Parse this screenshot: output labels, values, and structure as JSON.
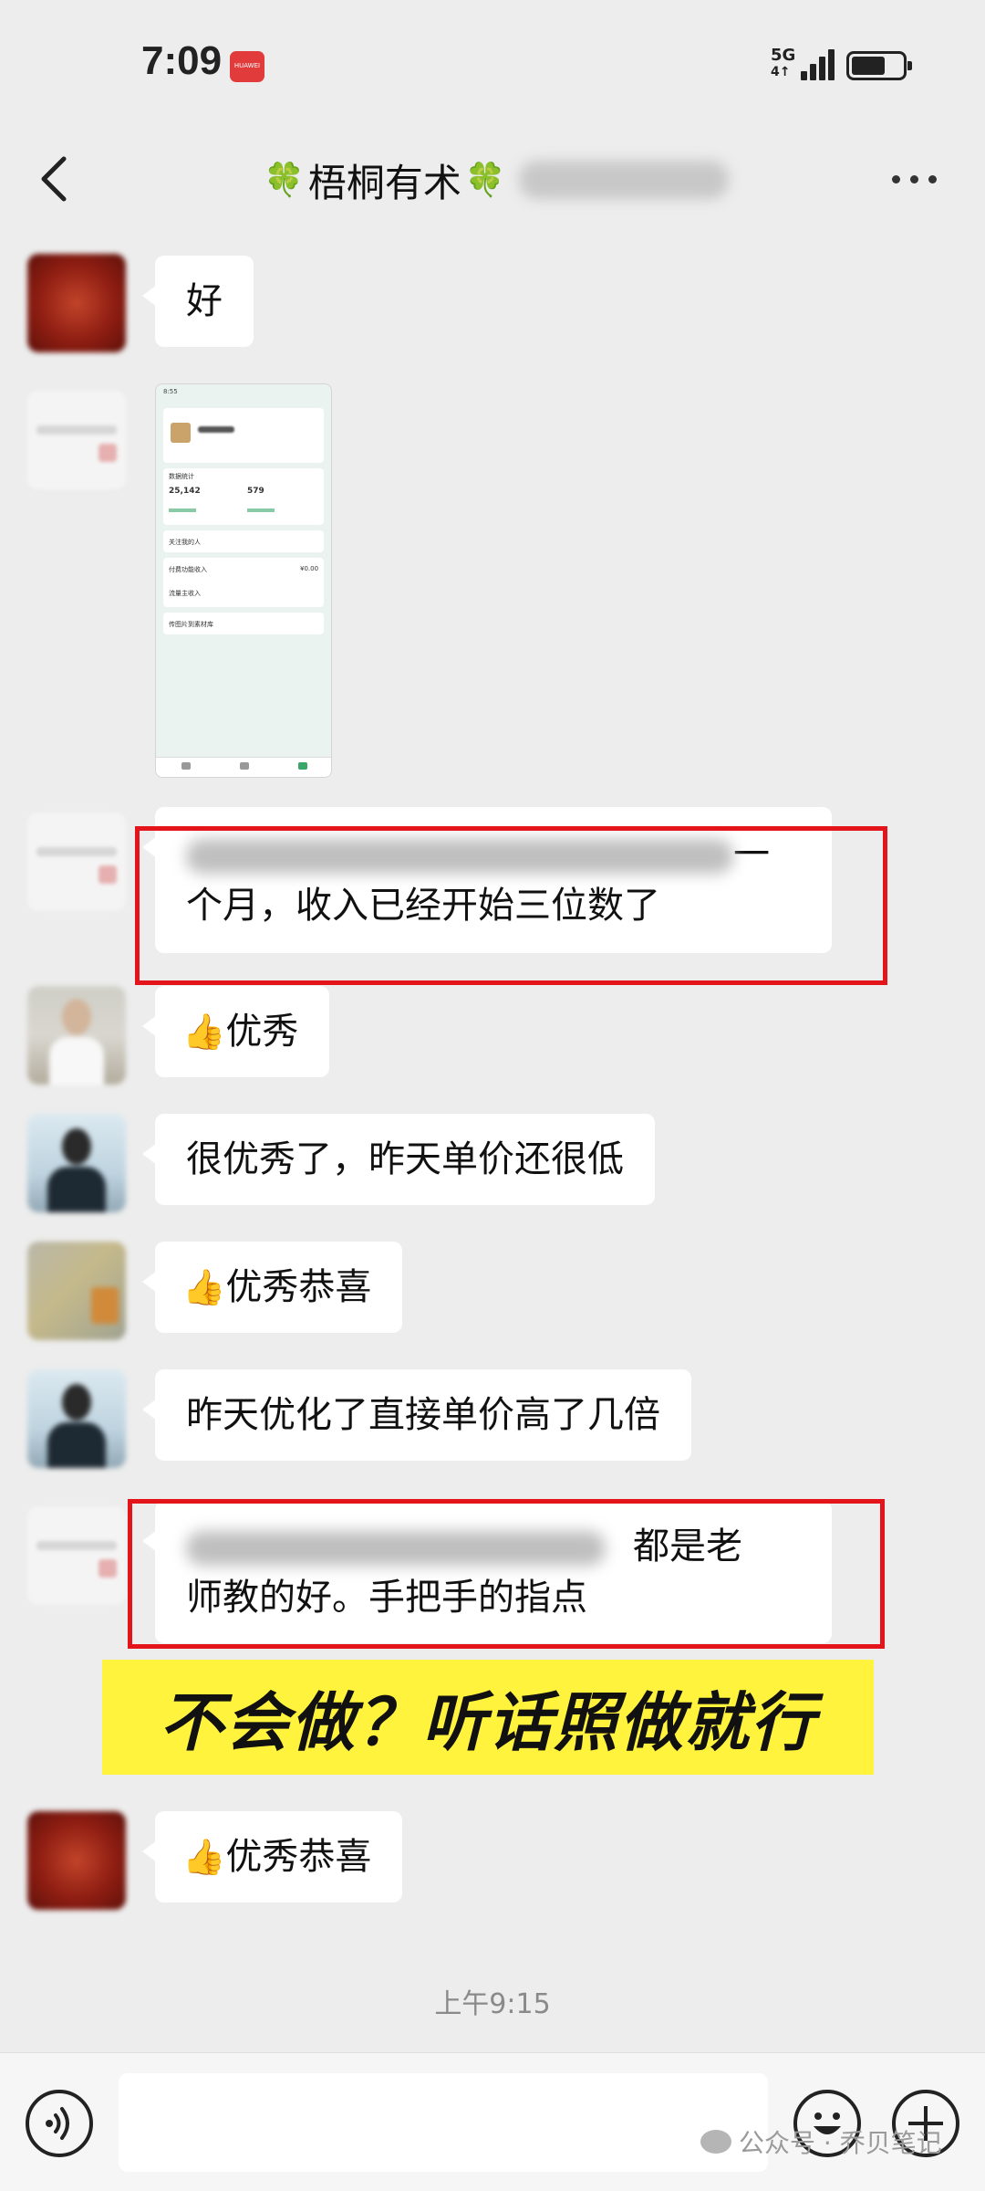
{
  "status_bar": {
    "time": "7:09",
    "notif_label": "HUAWEI",
    "network": "5G",
    "network_sub": "4↑"
  },
  "header": {
    "title": "梧桐有术",
    "clover_glyph": "🍀"
  },
  "messages": {
    "m1": "好",
    "m3_line2": "个月，收入已经开始三位数了",
    "m3_line1_tail": "一",
    "m4": "优秀",
    "m5": "很优秀了，昨天单价还很低",
    "m6": "优秀恭喜",
    "m7": "昨天优化了直接单价高了几倍",
    "m8_line1_tail": "都是老",
    "m8_line2": "师教的好。手把手的指点",
    "m9": "优秀恭喜"
  },
  "thumb_glyph": "👍",
  "shared_screenshot": {
    "status_time": "8:55",
    "stat_label": "数据统计",
    "value1": "25,142",
    "value2": "579",
    "row1": "关注我的人",
    "row2": "付费功能收入",
    "row2_value": "¥0.00",
    "row3": "流量主收入",
    "row4": "传图片到素材库"
  },
  "banner": {
    "text": "不会做？听话照做就行"
  },
  "timestamp": "上午9:15",
  "watermark": "公众号 · 乔贝笔记",
  "colors": {
    "highlight_box": "#e3151b",
    "banner_bg": "#fff33e",
    "chat_bg": "#ededed"
  },
  "icons": {
    "back": "chevron-left-icon",
    "more": "more-dots-icon",
    "voice": "voice-icon",
    "emoji": "emoji-icon",
    "plus": "plus-icon"
  }
}
